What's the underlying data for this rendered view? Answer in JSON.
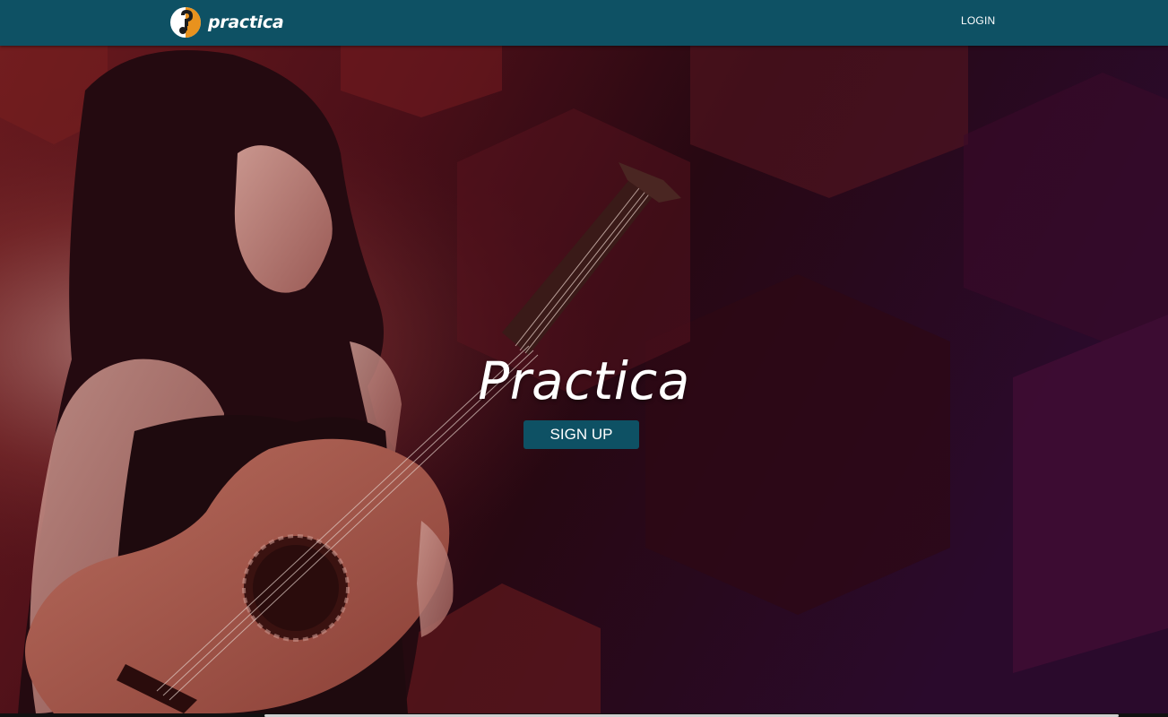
{
  "navbar": {
    "brand_name": "practica",
    "login_label": "LOGIN"
  },
  "hero": {
    "title": "Practica",
    "signup_label": "SIGN UP"
  },
  "colors": {
    "primary": "#0e5164",
    "logo_accent": "#e8921e",
    "background_dark": "#1a0810"
  },
  "icons": {
    "logo": "practica-logo-icon"
  }
}
